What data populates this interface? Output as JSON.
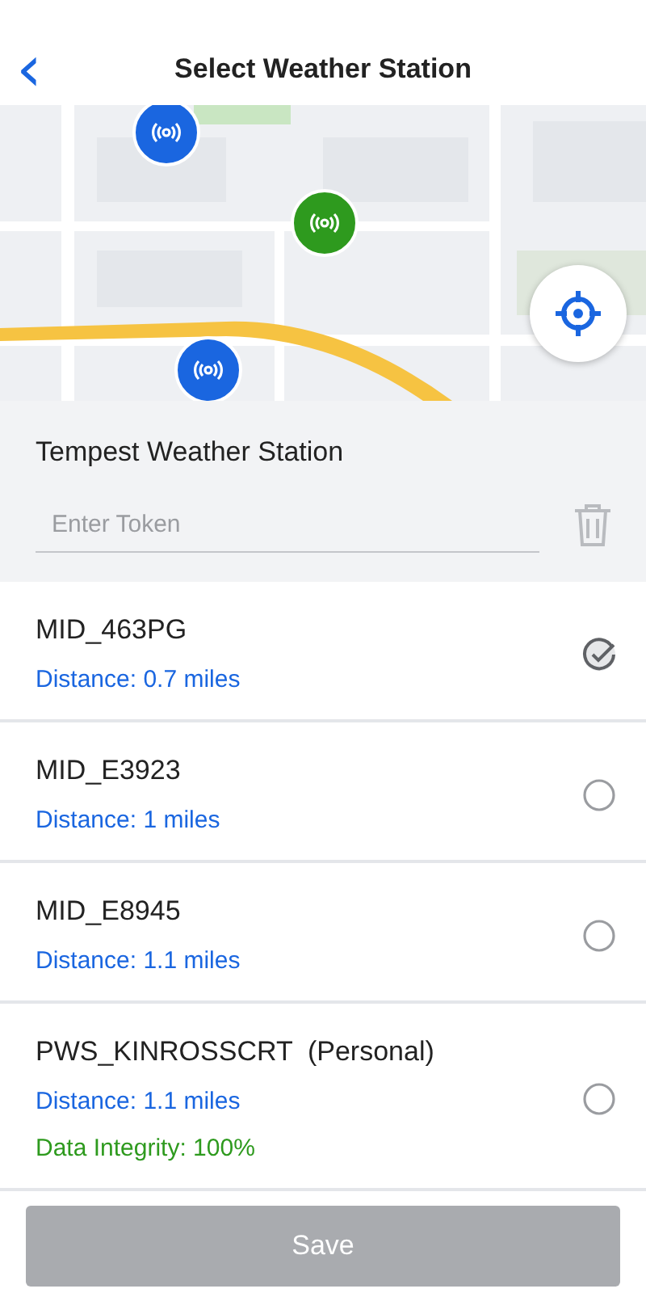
{
  "header": {
    "back_icon": "‹",
    "title": "Select Weather Station"
  },
  "map": {
    "pins": [
      {
        "color": "#1a66e0"
      },
      {
        "color": "#2e9a1e"
      },
      {
        "color": "#1a66e0"
      }
    ]
  },
  "tempest": {
    "title": "Tempest Weather Station",
    "token": {
      "placeholder": "Enter Token"
    }
  },
  "stations": [
    {
      "name": "MID_463PG",
      "distance": "Distance: 0.7 miles",
      "selected": true
    },
    {
      "name": "MID_E3923",
      "distance": "Distance: 1 miles",
      "selected": false
    },
    {
      "name": "MID_E8945",
      "distance": "Distance: 1.1 miles",
      "selected": false
    },
    {
      "name": "PWS_KINROSSCRT  (Personal)",
      "distance": "Distance: 1.1 miles",
      "integrity": "Data Integrity: 100%",
      "selected": false
    }
  ],
  "save": {
    "label": "Save",
    "disabled": true
  }
}
